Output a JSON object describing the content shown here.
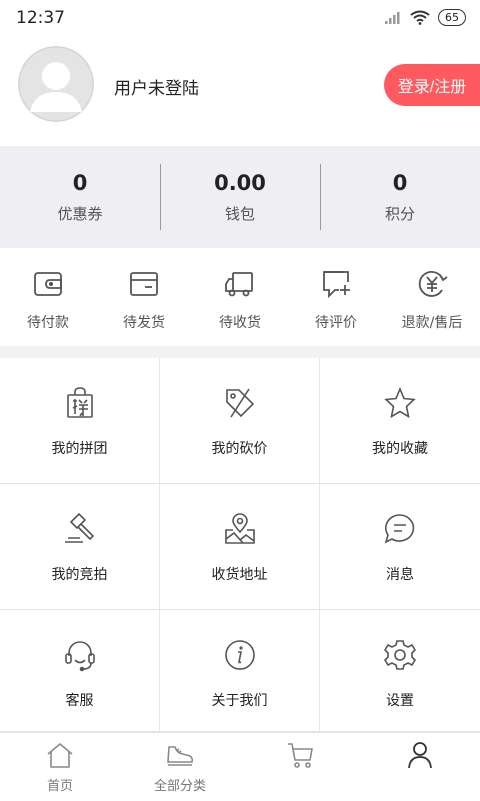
{
  "status": {
    "time": "12:37",
    "battery": "65"
  },
  "profile": {
    "username": "用户未登陆",
    "login_label": "登录/注册"
  },
  "stats": [
    {
      "value": "0",
      "label": "优惠券"
    },
    {
      "value": "0.00",
      "label": "钱包"
    },
    {
      "value": "0",
      "label": "积分"
    }
  ],
  "orders": [
    {
      "label": "待付款",
      "icon": "wallet-icon"
    },
    {
      "label": "待发货",
      "icon": "box-icon"
    },
    {
      "label": "待收货",
      "icon": "truck-icon"
    },
    {
      "label": "待评价",
      "icon": "comment-plus-icon"
    },
    {
      "label": "退款/售后",
      "icon": "yen-refresh-icon"
    }
  ],
  "menu": [
    {
      "label": "我的拼团",
      "icon": "group-buy-bag-icon"
    },
    {
      "label": "我的砍价",
      "icon": "price-tag-icon"
    },
    {
      "label": "我的收藏",
      "icon": "star-icon"
    },
    {
      "label": "我的竞拍",
      "icon": "auction-hammer-icon"
    },
    {
      "label": "收货地址",
      "icon": "map-pin-icon"
    },
    {
      "label": "消息",
      "icon": "message-icon"
    },
    {
      "label": "客服",
      "icon": "headset-icon"
    },
    {
      "label": "关于我们",
      "icon": "info-icon"
    },
    {
      "label": "设置",
      "icon": "gear-icon"
    }
  ],
  "tabs": [
    {
      "label": "首页",
      "icon": "home-icon"
    },
    {
      "label": "全部分类",
      "icon": "sneaker-icon"
    },
    {
      "label": "",
      "icon": "cart-icon"
    },
    {
      "label": "",
      "icon": "user-icon"
    }
  ],
  "colors": {
    "accent": "#ff5a5f",
    "stats_bg": "#eeeef3",
    "icon": "#555555"
  }
}
